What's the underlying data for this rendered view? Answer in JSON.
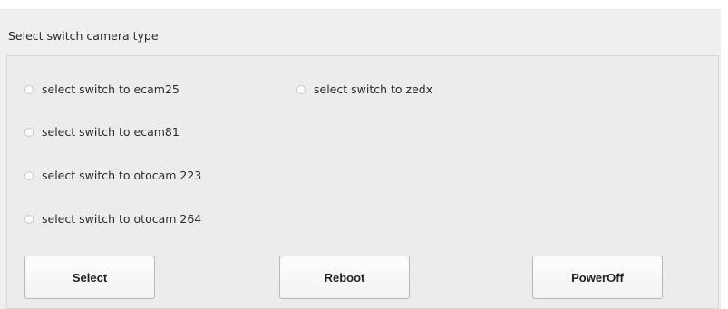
{
  "group": {
    "title": "Select switch camera type"
  },
  "radios": [
    {
      "label": "select switch to ecam25",
      "checked": false
    },
    {
      "label": "select switch to zedx",
      "checked": false
    },
    {
      "label": "select switch to ecam81",
      "checked": false
    },
    {
      "label": "select switch to otocam 223",
      "checked": false
    },
    {
      "label": "select switch to otocam 264",
      "checked": false
    }
  ],
  "buttons": {
    "select_label": "Select",
    "reboot_label": "Reboot",
    "poweroff_label": "PowerOff"
  }
}
